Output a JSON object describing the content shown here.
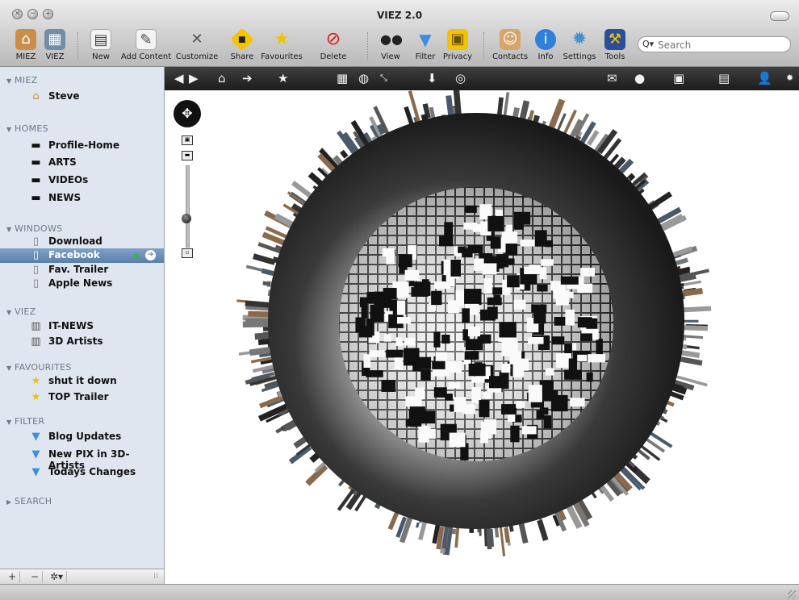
{
  "window": {
    "title": "VIEZ 2.0"
  },
  "toolbar": {
    "items": [
      {
        "label": "MIEZ",
        "icon": "home-icon"
      },
      {
        "label": "VIEZ",
        "icon": "viez-icon"
      },
      {
        "label": "New",
        "icon": "new-document-icon"
      },
      {
        "label": "Add Content",
        "icon": "add-content-icon"
      },
      {
        "label": "Customize",
        "icon": "tools-icon"
      },
      {
        "label": "Share",
        "icon": "share-sign-icon"
      },
      {
        "label": "Favourites",
        "icon": "star-icon"
      },
      {
        "label": "Delete",
        "icon": "delete-icon"
      },
      {
        "label": "View",
        "icon": "binoculars-icon"
      },
      {
        "label": "Filter",
        "icon": "filter-icon"
      },
      {
        "label": "Privacy",
        "icon": "lock-icon"
      },
      {
        "label": "Contacts",
        "icon": "contacts-icon"
      },
      {
        "label": "Info",
        "icon": "info-icon"
      },
      {
        "label": "Settings",
        "icon": "gear-icon"
      },
      {
        "label": "Tools",
        "icon": "toolbox-icon"
      }
    ],
    "search_placeholder": "Search"
  },
  "sidebar": {
    "sections": [
      {
        "title": "MIEZ",
        "expanded": true,
        "items": [
          {
            "label": "Steve",
            "icon": "home-icon"
          }
        ]
      },
      {
        "title": "HOMES",
        "expanded": true,
        "items": [
          {
            "label": "Profile-Home",
            "icon": "dock-icon"
          },
          {
            "label": "ARTS",
            "icon": "dock-icon"
          },
          {
            "label": "VIDEOs",
            "icon": "dock-icon"
          },
          {
            "label": "NEWS",
            "icon": "dock-icon"
          }
        ]
      },
      {
        "title": "WINDOWS",
        "expanded": true,
        "items": [
          {
            "label": "Download",
            "icon": "page-icon"
          },
          {
            "label": "Facebook",
            "icon": "page-icon",
            "selected": true
          },
          {
            "label": "Fav. Trailer",
            "icon": "page-icon"
          },
          {
            "label": "Apple News",
            "icon": "page-icon"
          }
        ]
      },
      {
        "title": "VIEZ",
        "expanded": true,
        "items": [
          {
            "label": "IT-NEWS",
            "icon": "viez-icon"
          },
          {
            "label": "3D Artists",
            "icon": "viez-icon"
          }
        ]
      },
      {
        "title": "FAVOURITES",
        "expanded": true,
        "items": [
          {
            "label": "shut it down",
            "icon": "star-icon"
          },
          {
            "label": "TOP Trailer",
            "icon": "star-icon"
          }
        ]
      },
      {
        "title": "FILTER",
        "expanded": true,
        "items": [
          {
            "label": "Blog Updates",
            "icon": "filter-icon"
          },
          {
            "label": "New PIX in 3D-Artists",
            "icon": "filter-icon"
          },
          {
            "label": "Todays Changes",
            "icon": "filter-icon"
          }
        ]
      },
      {
        "title": "SEARCH",
        "expanded": false,
        "items": []
      }
    ],
    "bottom": {
      "add": "+",
      "remove": "−",
      "action": "✲▾"
    }
  },
  "colors": {
    "selection": "#5a80ad",
    "sidebar_bg": "#dfe6ef",
    "navbar_bg": "#2a2a2a",
    "online_dot": "#27c12e"
  }
}
